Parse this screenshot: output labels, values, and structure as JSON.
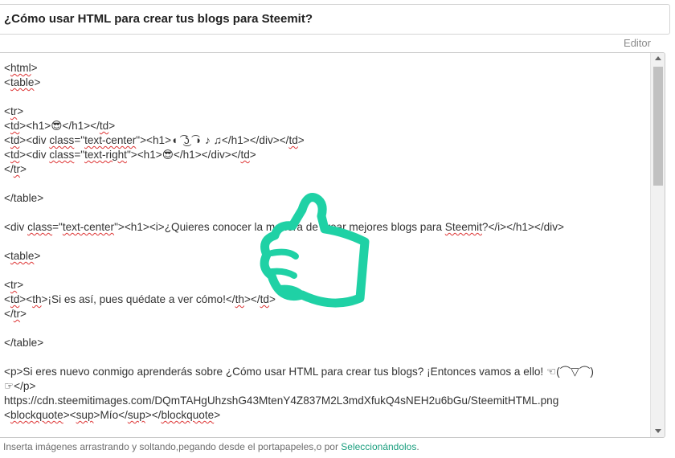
{
  "post": {
    "title": "¿Cómo usar HTML para crear tus blogs para Steemit?"
  },
  "editor": {
    "mode_label": "Editor",
    "lines": [
      [
        "<",
        [
          "html",
          "spell"
        ],
        ">"
      ],
      [
        "<",
        [
          "table",
          "spell"
        ],
        ">"
      ],
      [
        ""
      ],
      [
        "<",
        [
          "tr",
          "spell"
        ],
        ">"
      ],
      [
        "<",
        [
          "td",
          "spell"
        ],
        "><h1>😎</h1></",
        [
          "td",
          "spell"
        ],
        ">"
      ],
      [
        "<",
        [
          "td",
          "spell"
        ],
        "><div ",
        [
          "class",
          "spell"
        ],
        "=\"",
        [
          "text-center",
          "spell"
        ],
        "\"><h1>◖ ͡ ͜ʖ ͡ ◗ ♪ ♫</h1></div></",
        [
          "td",
          "spell"
        ],
        ">"
      ],
      [
        "<",
        [
          "td",
          "spell"
        ],
        "><div ",
        [
          "class",
          "spell"
        ],
        "=\"",
        [
          "text-right",
          "spell"
        ],
        "\"><h1>😎</h1></div></",
        [
          "td",
          "spell"
        ],
        ">"
      ],
      [
        "</",
        [
          "tr",
          "spell"
        ],
        ">"
      ],
      [
        ""
      ],
      [
        "</table>"
      ],
      [
        ""
      ],
      [
        "<div ",
        [
          "class",
          "spell"
        ],
        "=\"",
        [
          "text-center",
          "spell"
        ],
        "\"><h1><i>¿Quieres conocer la manera de crear mejores blogs para ",
        [
          "Steemit",
          "spell"
        ],
        "?</i></h1></div>"
      ],
      [
        ""
      ],
      [
        "<",
        [
          "table",
          "spell"
        ],
        ">"
      ],
      [
        ""
      ],
      [
        "<",
        [
          "tr",
          "spell"
        ],
        ">"
      ],
      [
        "<",
        [
          "td",
          "spell"
        ],
        "><",
        [
          "th",
          "spell"
        ],
        ">¡Si es así, pues quédate a ver cómo!</",
        [
          "th",
          "spell"
        ],
        "></",
        [
          "td",
          "spell"
        ],
        ">"
      ],
      [
        "</",
        [
          "tr",
          "spell"
        ],
        ">"
      ],
      [
        ""
      ],
      [
        "</table>"
      ],
      [
        ""
      ],
      [
        "<p>Si eres nuevo conmigo aprenderás sobre ¿Cómo usar HTML para crear tus blogs? ¡Entonces vamos a ello! ☜(⌒▽⌒)"
      ],
      [
        "☞</p>"
      ],
      [
        "https://cdn.steemitimages.com/DQmTAHgUhzshG43MtenY4Z837M2L3mdXfukQ4sNEH2u6bGu/SteemitHTML.png"
      ],
      [
        "<",
        [
          "blockquote",
          "spell"
        ],
        "><",
        [
          "sup",
          "spell"
        ],
        ">Mío</",
        [
          "sup",
          "spell"
        ],
        "></",
        [
          "blockquote",
          "spell"
        ],
        ">"
      ]
    ]
  },
  "footer": {
    "hint": "Inserta imágenes arrastrando y soltando,pegando desde el portapapeles,o por ",
    "link": "Seleccionándolos",
    "end": "."
  },
  "colors": {
    "accent": "#1a9e7e",
    "overlay_hand": "#1fd1a5"
  },
  "icons": {
    "overlay": "thumbs-up-hand-icon"
  }
}
